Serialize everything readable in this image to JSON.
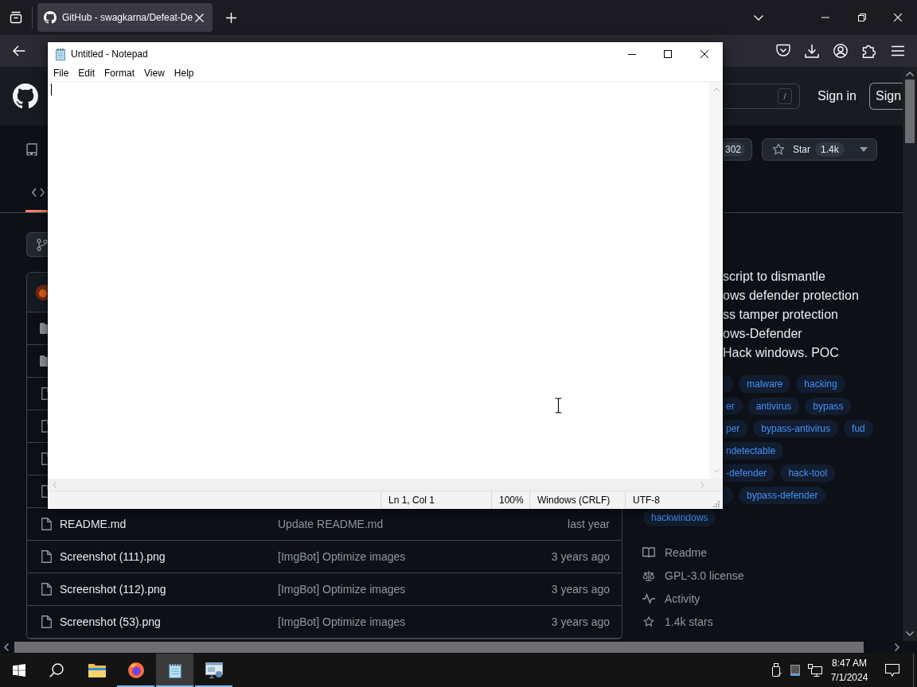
{
  "browser": {
    "tabs": [
      {
        "title": "GitHub - swagkarna/Defeat-De",
        "selected": true
      }
    ]
  },
  "github": {
    "header": {
      "search_key": "/",
      "sign_in": "Sign in",
      "sign_up": "Sign"
    },
    "repo_actions": {
      "fork_count": "302",
      "star_label": "Star",
      "star_count": "1.4k"
    },
    "repo_tabs": [
      {
        "kind": "code",
        "selected": true
      }
    ],
    "file_list": {
      "rows": [
        {
          "kind": "folder"
        },
        {
          "kind": "folder"
        },
        {
          "kind": "file"
        },
        {
          "kind": "file"
        },
        {
          "kind": "file"
        },
        {
          "kind": "file"
        },
        {
          "kind": "file",
          "name": "README.md",
          "message": "Update README.md",
          "time": "last year"
        },
        {
          "kind": "file",
          "name": "Screenshot (111).png",
          "message": "[ImgBot] Optimize images",
          "time": "3 years ago"
        },
        {
          "kind": "file",
          "name": "Screenshot (112).png",
          "message": "[ImgBot] Optimize images",
          "time": "3 years ago"
        },
        {
          "kind": "file",
          "name": "Screenshot (53).png",
          "message": "[ImgBot] Optimize images",
          "time": "3 years ago"
        }
      ]
    },
    "about": {
      "description_lines": [
        "script to dismantle",
        "ows defender protection",
        "ss tamper protection",
        "ows-Defender",
        "Hack windows. POC"
      ],
      "topic_rows": [
        [
          {
            "cut": true
          },
          {
            "label": "malware",
            "cut": false
          },
          {
            "label": "hacking",
            "cut": false
          }
        ],
        [
          {
            "label": "er",
            "cut": true
          },
          {
            "label": "antivirus",
            "cut": false
          },
          {
            "label": "bypass",
            "cut": false
          }
        ],
        [
          {
            "label": "per",
            "cut": true
          },
          {
            "label": "bypass-antivirus",
            "cut": false
          },
          {
            "label": "fud",
            "cut": false
          }
        ],
        [
          {
            "label": "ndetectable",
            "cut": true
          }
        ],
        [
          {
            "label": "-defender",
            "cut": true
          },
          {
            "label": "hack-tool",
            "cut": false
          }
        ],
        [
          {
            "cut": true
          },
          {
            "label": "bypass-defender",
            "cut": false
          }
        ],
        [
          {
            "label": "hackwindows",
            "cut": false
          }
        ]
      ],
      "links": [
        {
          "kind": "readme",
          "label": "Readme"
        },
        {
          "kind": "license",
          "label": "GPL-3.0 license"
        },
        {
          "kind": "activity",
          "label": "Activity"
        },
        {
          "kind": "stars",
          "label": "1.4k stars"
        }
      ]
    }
  },
  "notepad": {
    "title": "Untitled - Notepad",
    "menu": [
      "File",
      "Edit",
      "Format",
      "View",
      "Help"
    ],
    "status": [
      "Ln 1, Col 1",
      "100%",
      "Windows (CRLF)",
      "UTF-8"
    ]
  },
  "taskbar": {
    "apps": [
      {
        "kind": "explorer",
        "open": false,
        "selected": false
      },
      {
        "kind": "browser",
        "open": true,
        "selected": false
      },
      {
        "kind": "notepad",
        "open": true,
        "selected": true
      },
      {
        "kind": "remote",
        "open": true,
        "selected": false
      }
    ],
    "time": "8:47 AM",
    "date": "7/1/2024"
  }
}
